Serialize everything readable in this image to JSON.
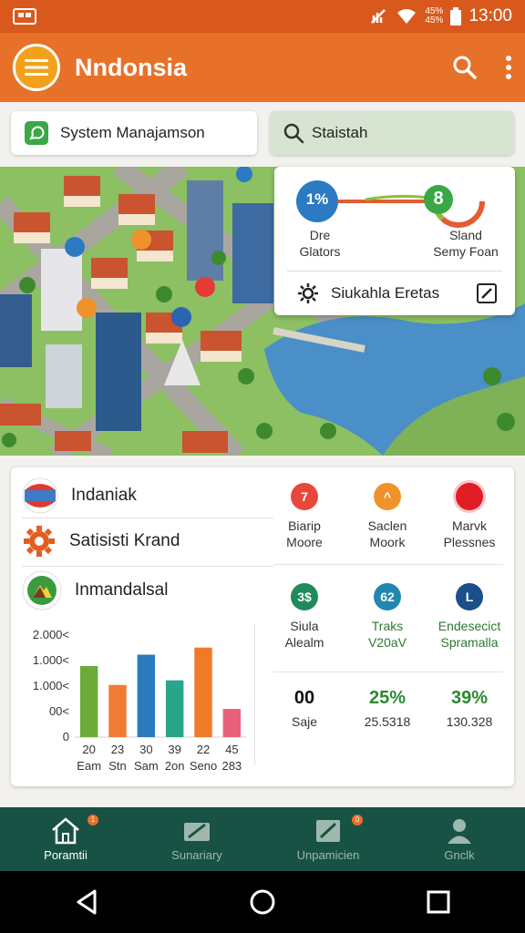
{
  "status": {
    "battery_pct_top": "45%",
    "battery_pct_bottom": "45%",
    "time": "13:00"
  },
  "app": {
    "title": "Nndonsia"
  },
  "search": {
    "left_label": "System Manajamson",
    "right_label": "Staistah"
  },
  "overlay": {
    "left_value": "1%",
    "right_value": "8",
    "left_label_1": "Dre",
    "left_label_2": "Glators",
    "right_label_1": "Sland",
    "right_label_2": "Semy Foan",
    "action_label": "Siukahla Eretas"
  },
  "lists": [
    {
      "label": "Indaniak"
    },
    {
      "label": "Satisisti Krand"
    },
    {
      "label": "Inmandalsal"
    }
  ],
  "grid": [
    {
      "value": "7",
      "label_1": "Biarip",
      "label_2": "Moore",
      "color": "#e8473b"
    },
    {
      "value": "^",
      "label_1": "Saclen",
      "label_2": "Moork",
      "color": "#f0922b"
    },
    {
      "value": "",
      "label_1": "Marvk",
      "label_2": "Plessnes",
      "color": "#e21c25"
    },
    {
      "value": "3$",
      "label_1": "Siula",
      "label_2": "Alealm",
      "color": "#1f8a5c"
    },
    {
      "value": "62",
      "label_1": "Traks",
      "label_2": "V20aV",
      "color": "#2187b0"
    },
    {
      "value": "L",
      "label_1": "Endesecict",
      "label_2": "Spramalla",
      "color": "#1c4e8a"
    }
  ],
  "stats": [
    {
      "big": "00",
      "small": "Saje",
      "color": "#111111"
    },
    {
      "big": "25%",
      "small": "25.5318",
      "color": "#2a8a2e"
    },
    {
      "big": "39%",
      "small": "130.328",
      "color": "#2a8a2e"
    }
  ],
  "chart_data": {
    "type": "bar",
    "title": "",
    "xlabel": "",
    "ylabel": "",
    "yticks": [
      "2.000<",
      "1.000<",
      "1.000<",
      "00<",
      "0"
    ],
    "categories": [
      "20",
      "23",
      "30",
      "39",
      "22",
      "45"
    ],
    "category_sublabels": [
      "Eam",
      "Stn",
      "Sam",
      "2on",
      "Seno",
      "283"
    ],
    "values": [
      1.69,
      1.24,
      1.96,
      1.35,
      2.13,
      0.67
    ],
    "ylim": [
      0,
      2.6
    ],
    "colors": [
      "#6aab3a",
      "#f07c33",
      "#2a7bbd",
      "#2aa58a",
      "#ef7a28",
      "#e8607c"
    ]
  },
  "bottomnav": [
    {
      "label": "Poramtii",
      "active": true,
      "badge": "1"
    },
    {
      "label": "Sunariary",
      "active": false,
      "badge": ""
    },
    {
      "label": "Unpamicien",
      "active": false,
      "badge": "0"
    },
    {
      "label": "Gnclk",
      "active": false,
      "badge": ""
    }
  ]
}
